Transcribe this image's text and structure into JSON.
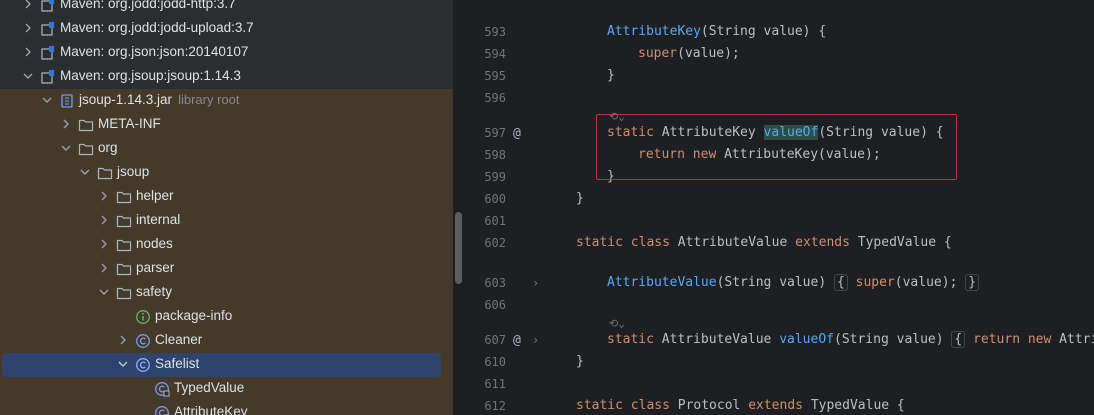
{
  "tree": {
    "items": [
      {
        "label": "Maven: org.jodd:jodd-http:3.7",
        "hint": "",
        "icon": "maven-library-icon",
        "expanded": false
      },
      {
        "label": "Maven: org.jodd:jodd-upload:3.7",
        "hint": "",
        "icon": "maven-library-icon",
        "expanded": false
      },
      {
        "label": "Maven: org.json:json:20140107",
        "hint": "",
        "icon": "maven-library-icon",
        "expanded": false
      },
      {
        "label": "Maven: org.jsoup:jsoup:1.14.3",
        "hint": "",
        "icon": "maven-library-icon",
        "expanded": true
      },
      {
        "label": "jsoup-1.14.3.jar",
        "hint": "library root",
        "icon": "jar-icon",
        "expanded": true
      },
      {
        "label": "META-INF",
        "hint": "",
        "icon": "folder-icon",
        "expanded": false
      },
      {
        "label": "org",
        "hint": "",
        "icon": "folder-icon",
        "expanded": true
      },
      {
        "label": "jsoup",
        "hint": "",
        "icon": "folder-icon",
        "expanded": true
      },
      {
        "label": "helper",
        "hint": "",
        "icon": "folder-icon",
        "expanded": false
      },
      {
        "label": "internal",
        "hint": "",
        "icon": "folder-icon",
        "expanded": false
      },
      {
        "label": "nodes",
        "hint": "",
        "icon": "folder-icon",
        "expanded": false
      },
      {
        "label": "parser",
        "hint": "",
        "icon": "folder-icon",
        "expanded": false
      },
      {
        "label": "safety",
        "hint": "",
        "icon": "folder-icon",
        "expanded": true
      },
      {
        "label": "package-info",
        "hint": "",
        "icon": "package-info-icon",
        "expanded": false
      },
      {
        "label": "Cleaner",
        "hint": "",
        "icon": "class-icon",
        "expanded": false
      },
      {
        "label": "Safelist",
        "hint": "",
        "icon": "class-icon",
        "expanded": true
      },
      {
        "label": "TypedValue",
        "hint": "",
        "icon": "nested-class-icon",
        "expanded": false
      },
      {
        "label": "AttributeKey",
        "hint": "",
        "icon": "nested-class-icon",
        "expanded": false
      }
    ],
    "selected": "Safelist"
  },
  "editor": {
    "line_numbers": {
      "l593": "593",
      "l594": "594",
      "l595": "595",
      "l596": "596",
      "l597": "597",
      "l598": "598",
      "l599": "599",
      "l600": "600",
      "l601": "601",
      "l602": "602",
      "l603": "603",
      "l606": "606",
      "l607": "607",
      "l610": "610",
      "l611": "611",
      "l612": "612"
    },
    "gutter": {
      "override_icon": "@",
      "fold_icon": "›"
    },
    "inlay_hint": "⟲⌄",
    "code": {
      "l593": {
        "name": "AttributeKey",
        "rest": "(String value) {"
      },
      "l594": {
        "kw": "super",
        "rest": "(value);"
      },
      "l595": {
        "text": "}"
      },
      "l597": {
        "kw": "static",
        "type": " AttributeKey ",
        "method": "valueOf",
        "rest": "(String value) {"
      },
      "l598": {
        "kw": "return new",
        "rest": " AttributeKey(value);"
      },
      "l599": {
        "text": "}"
      },
      "l600": {
        "text": "}"
      },
      "l602": {
        "kw1": "static class",
        "mid": " AttributeValue ",
        "kw2": "extends",
        "rest": " TypedValue {"
      },
      "l603": {
        "name": "AttributeValue",
        "rest": "(String value)",
        "open": "{",
        "kw": "super",
        "rest2": "(value);",
        "close": "}"
      },
      "l607": {
        "kw": "static",
        "type": " AttributeValue ",
        "method": "valueOf",
        "rest": "(String value)",
        "open": "{",
        "kw2": "return new",
        "rest2": " Attrib"
      },
      "l610": {
        "text": "}"
      },
      "l612": {
        "kw1": "static class",
        "mid": " Protocol ",
        "kw2": "extends",
        "rest": " TypedValue {"
      }
    }
  },
  "colors": {
    "selection": "#2e436e",
    "library_bg": "#45392a",
    "annotation_box": "#c0323a",
    "keyword": "#cf8e6d",
    "method": "#56a8f5"
  }
}
